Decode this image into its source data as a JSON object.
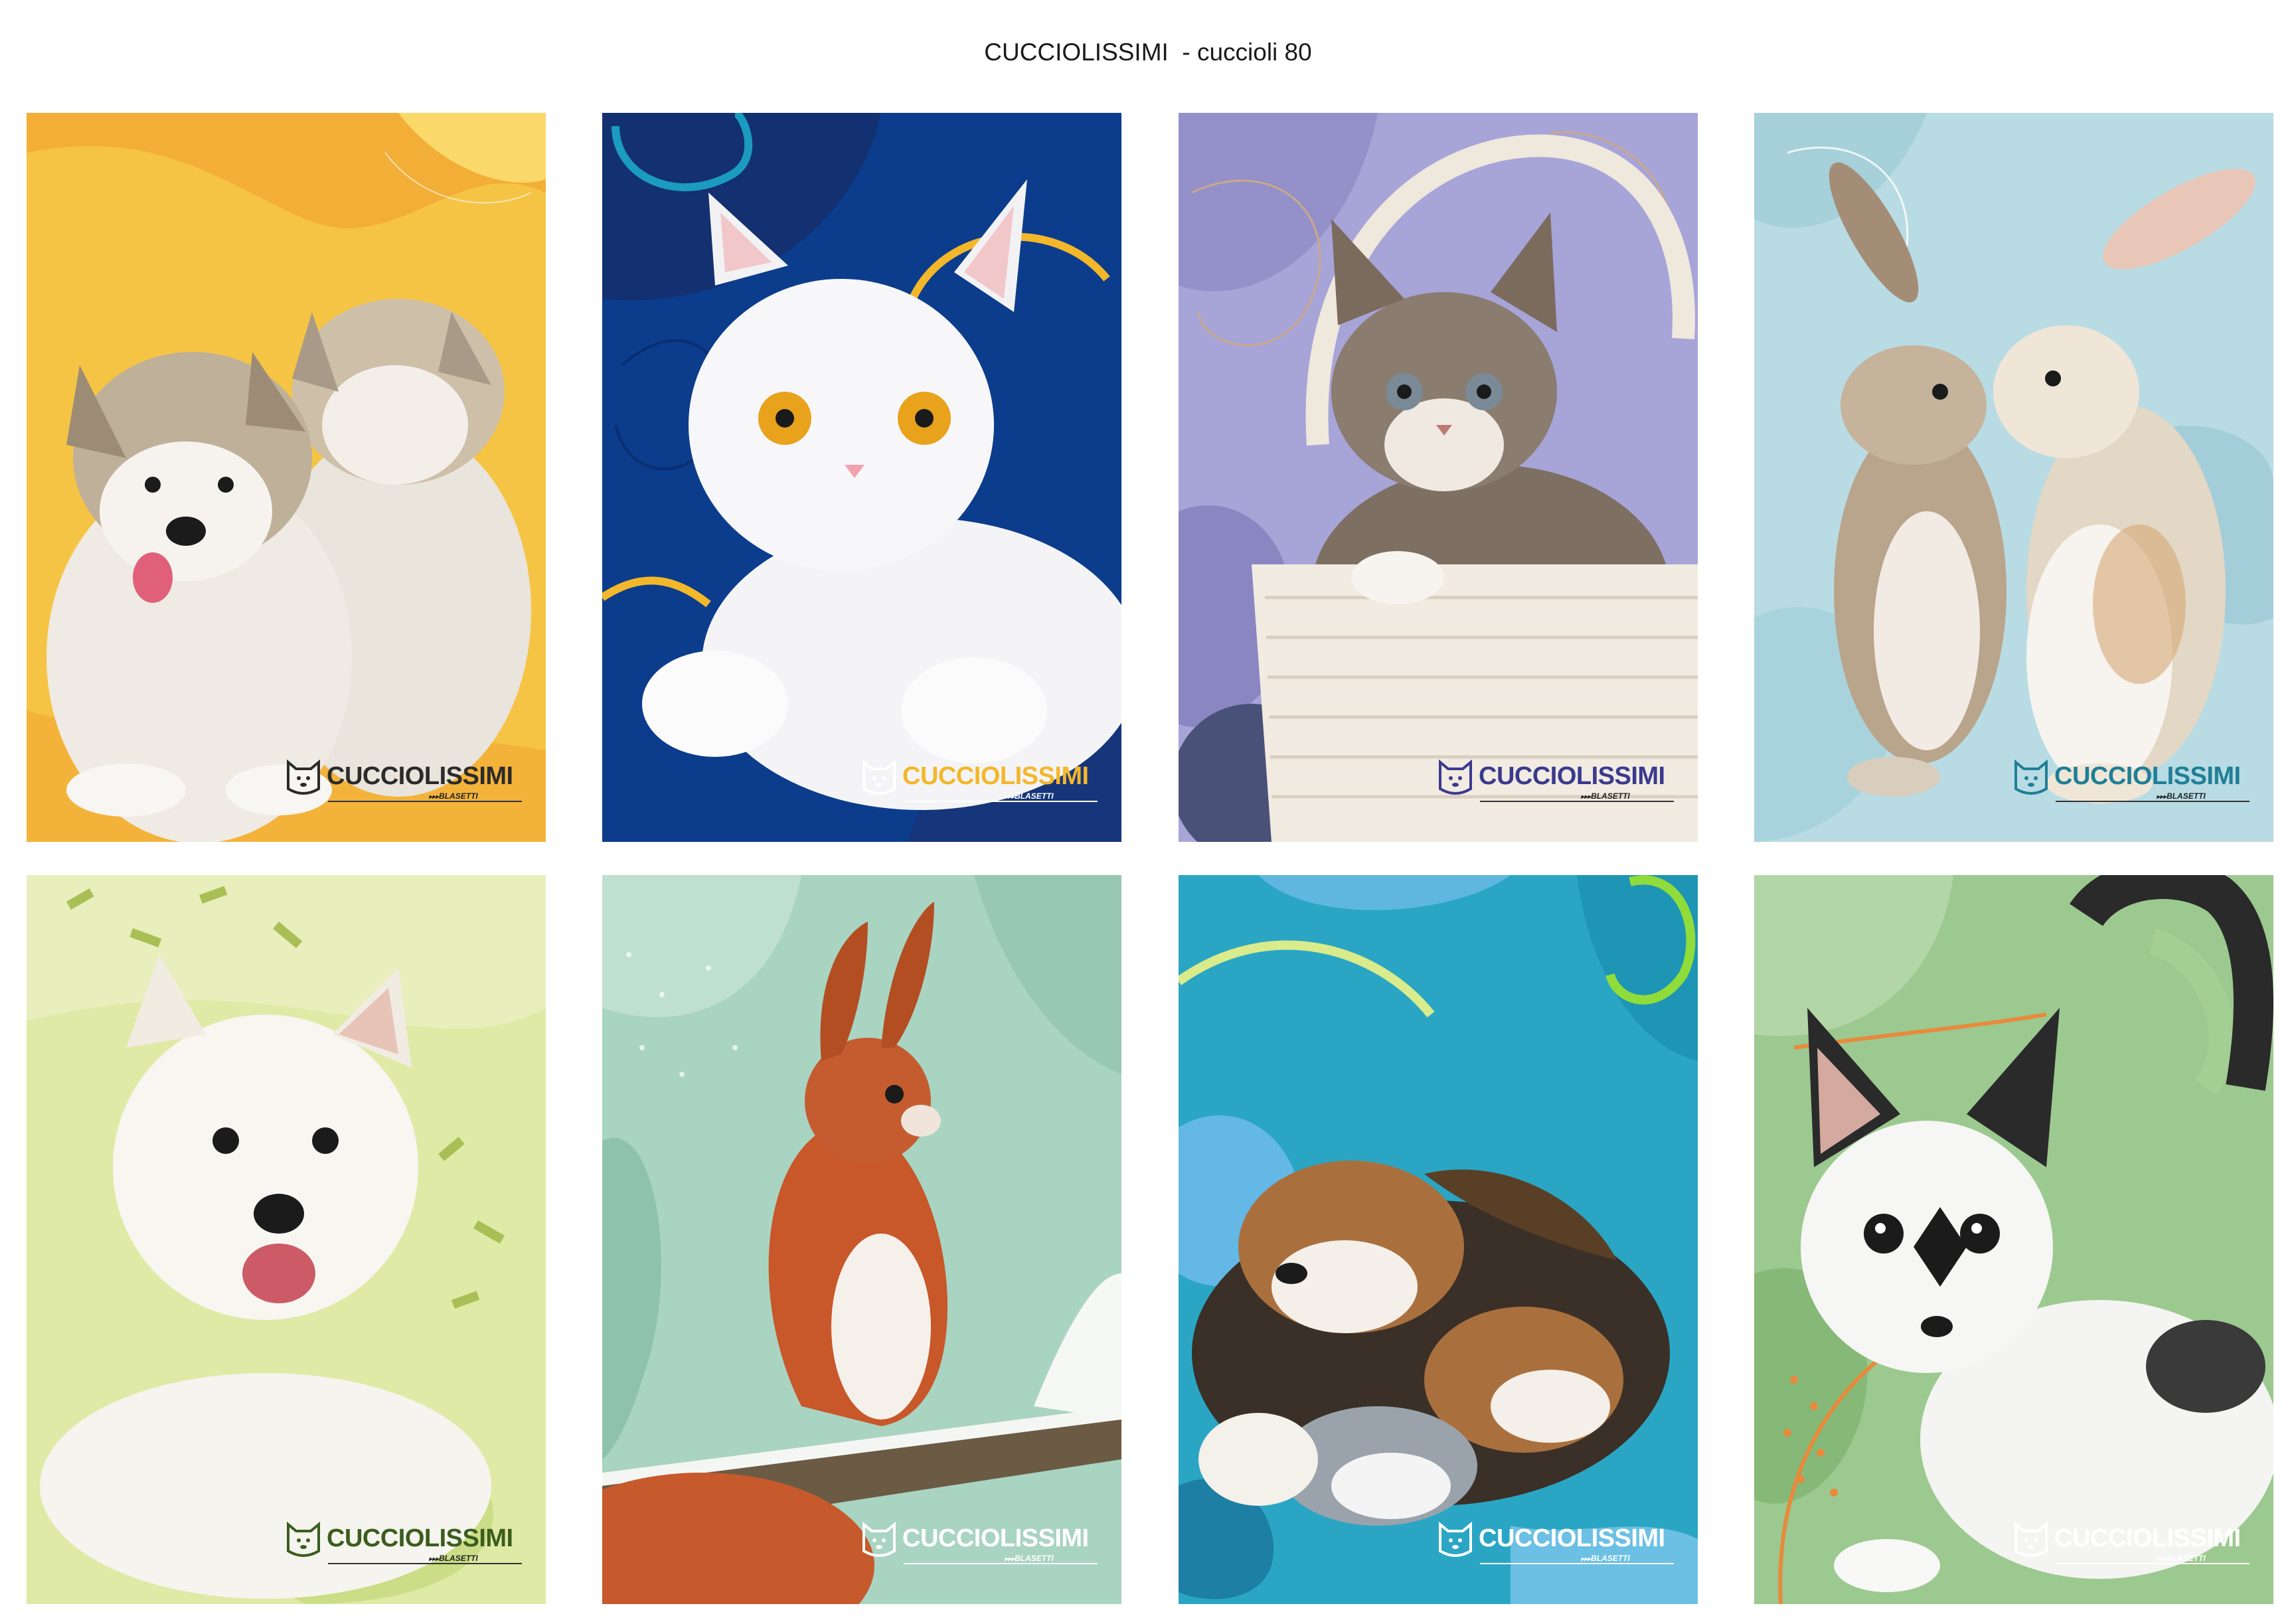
{
  "page_title": "CUCCIOLISSIMI  - cuccioli 80",
  "covers": [
    {
      "brand": "CUCCIOLISSIMI",
      "publisher": "BLASETTI",
      "subject": "husky-puppies",
      "bg": "#f6c445",
      "brand_color": "#2b2b2b"
    },
    {
      "brand": "CUCCIOLISSIMI",
      "publisher": "BLASETTI",
      "subject": "white-kitten",
      "bg": "#0c3c8c",
      "brand_color": "#f3b72a"
    },
    {
      "brand": "CUCCIOLISSIMI",
      "publisher": "BLASETTI",
      "subject": "kitten-in-basket",
      "bg": "#a7a4d8",
      "brand_color": "#3b3a8f"
    },
    {
      "brand": "CUCCIOLISSIMI",
      "publisher": "BLASETTI",
      "subject": "rabbits",
      "bg": "#b9dbe3",
      "brand_color": "#1f7f96"
    },
    {
      "brand": "CUCCIOLISSIMI",
      "publisher": "BLASETTI",
      "subject": "westie-dog",
      "bg": "#dfeaa6",
      "brand_color": "#3b5d1e"
    },
    {
      "brand": "CUCCIOLISSIMI",
      "publisher": "BLASETTI",
      "subject": "red-squirrel",
      "bg": "#a9d4c2",
      "brand_color": "#ffffff"
    },
    {
      "brand": "CUCCIOLISSIMI",
      "publisher": "BLASETTI",
      "subject": "beagle-puppies-and-kitten",
      "bg": "#2aa6c4",
      "brand_color": "#ffffff"
    },
    {
      "brand": "CUCCIOLISSIMI",
      "publisher": "BLASETTI",
      "subject": "black-white-kitten",
      "bg": "#9cc98f",
      "brand_color": "#ffffff"
    }
  ]
}
